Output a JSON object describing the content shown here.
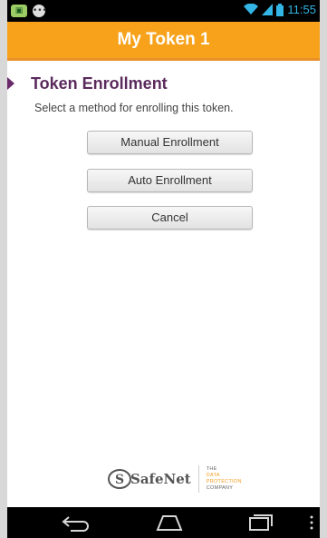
{
  "status_bar": {
    "time": "11:55",
    "icons": [
      "notification-icon",
      "chat-icon",
      "wifi-icon",
      "signal-icon",
      "battery-icon"
    ],
    "accent_color": "#33b5e5"
  },
  "header": {
    "title": "My Token 1",
    "color": "#f7a21a"
  },
  "enrollment": {
    "title": "Token Enrollment",
    "description": "Select a method for enrolling this token.",
    "buttons": {
      "manual": "Manual Enrollment",
      "auto": "Auto Enrollment",
      "cancel": "Cancel"
    },
    "title_color": "#5b2a5c"
  },
  "footer": {
    "logo_text": "SafeNet",
    "tagline": [
      "THE",
      "DATA",
      "PROTECTION",
      "COMPANY"
    ]
  },
  "nav_bar": {
    "icons": [
      "back-icon",
      "home-icon",
      "recent-apps-icon",
      "menu-icon"
    ]
  }
}
